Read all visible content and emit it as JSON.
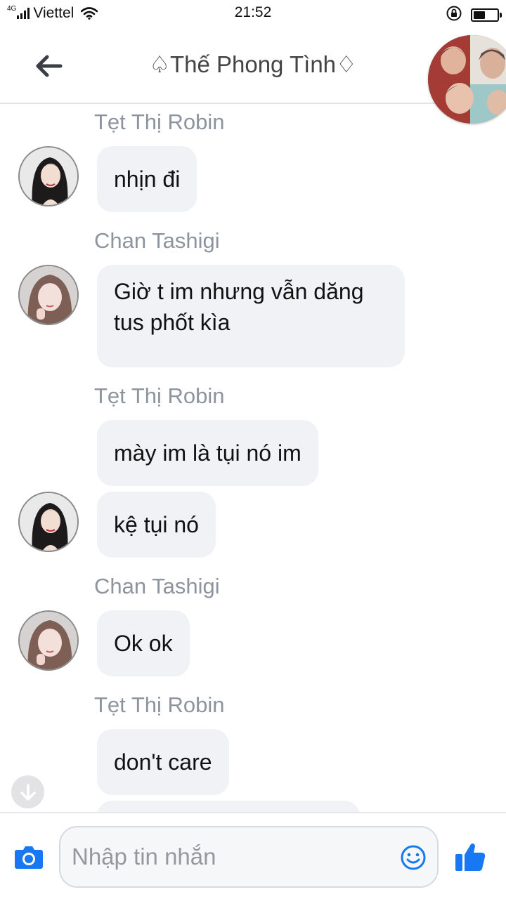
{
  "status_bar": {
    "network_type": "4G",
    "carrier": "Viettel",
    "time": "21:52",
    "battery_level_percent": 50,
    "signal_bars": 4
  },
  "header": {
    "title": "♤Thế Phong Tình♢",
    "back_icon": "arrow-left-icon",
    "group_avatar_icon": "group-photo"
  },
  "messages": [
    {
      "sender": "Tẹt Thị Robin",
      "texts": [
        "nhịn đi"
      ],
      "avatar": "robin"
    },
    {
      "sender": "Chan Tashigi",
      "texts": [
        "Giờ t im nhưng vẫn dăng tus phốt kìa"
      ],
      "avatar": "tashigi"
    },
    {
      "sender": "Tẹt Thị Robin",
      "texts": [
        "mày im là tụi nó im",
        "kệ tụi nó"
      ],
      "avatar": "robin"
    },
    {
      "sender": "Chan Tashigi",
      "texts": [
        "Ok ok"
      ],
      "avatar": "tashigi"
    },
    {
      "sender": "Tẹt Thị Robin",
      "texts": [
        "don't care"
      ],
      "avatar": "robin"
    }
  ],
  "message_lines": {
    "tashigi_line1": "Giờ t im nhưng vẫn dăng",
    "tashigi_line2": "tus phốt kìa"
  },
  "composer": {
    "placeholder": "Nhập tin nhắn",
    "camera_icon": "camera-icon",
    "emoji_icon": "smiley-icon",
    "like_icon": "thumbs-up-icon"
  },
  "colors": {
    "accent": "#1877f2",
    "bubble": "#f1f2f6",
    "sender_name": "#8d949e"
  }
}
